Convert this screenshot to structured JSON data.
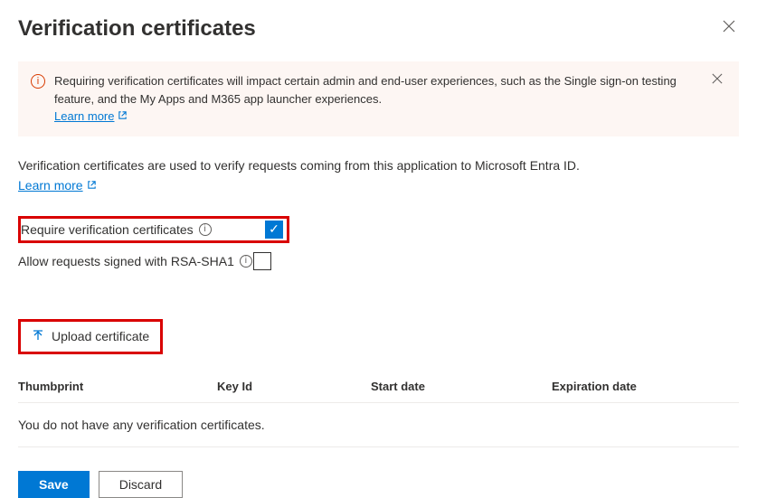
{
  "header": {
    "title": "Verification certificates"
  },
  "alert": {
    "text": "Requiring verification certificates will impact certain admin and end-user experiences, such as the Single sign-on testing feature, and the My Apps and M365 app launcher experiences.",
    "learn_more": "Learn more"
  },
  "description": {
    "text": "Verification certificates are used to verify requests coming from this application to Microsoft Entra ID.",
    "learn_more": "Learn more"
  },
  "options": {
    "require_label": "Require verification certificates",
    "require_checked": true,
    "allow_rsa_label": "Allow requests signed with RSA-SHA1",
    "allow_rsa_checked": false
  },
  "upload": {
    "button_label": "Upload certificate"
  },
  "table": {
    "columns": {
      "thumbprint": "Thumbprint",
      "key_id": "Key Id",
      "start_date": "Start date",
      "expiration_date": "Expiration date"
    },
    "empty_message": "You do not have any verification certificates."
  },
  "footer": {
    "save": "Save",
    "discard": "Discard"
  }
}
